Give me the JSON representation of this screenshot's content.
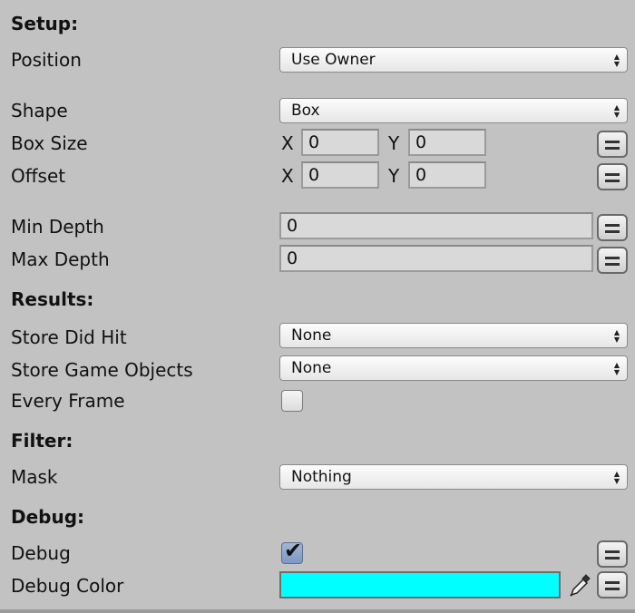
{
  "setup": {
    "header": "Setup:",
    "position": {
      "label": "Position",
      "value": "Use Owner"
    },
    "shape": {
      "label": "Shape",
      "value": "Box"
    },
    "box_size": {
      "label": "Box Size",
      "x_label": "X",
      "x": "0",
      "y_label": "Y",
      "y": "0"
    },
    "offset": {
      "label": "Offset",
      "x_label": "X",
      "x": "0",
      "y_label": "Y",
      "y": "0"
    },
    "min_depth": {
      "label": "Min Depth",
      "value": "0"
    },
    "max_depth": {
      "label": "Max Depth",
      "value": "0"
    }
  },
  "results": {
    "header": "Results:",
    "store_did_hit": {
      "label": "Store Did Hit",
      "value": "None"
    },
    "store_game_objects": {
      "label": "Store Game Objects",
      "value": "None"
    },
    "every_frame": {
      "label": "Every Frame",
      "checked": false
    }
  },
  "filter": {
    "header": "Filter:",
    "mask": {
      "label": "Mask",
      "value": "Nothing"
    }
  },
  "debug": {
    "header": "Debug:",
    "debug": {
      "label": "Debug",
      "checked": true
    },
    "debug_color": {
      "label": "Debug Color",
      "color": "#00ffff"
    }
  },
  "icons": {
    "dropdown_arrow": "updown-arrow-icon",
    "menu_button": "equals-menu-icon",
    "color_picker": "eyedropper-icon"
  }
}
